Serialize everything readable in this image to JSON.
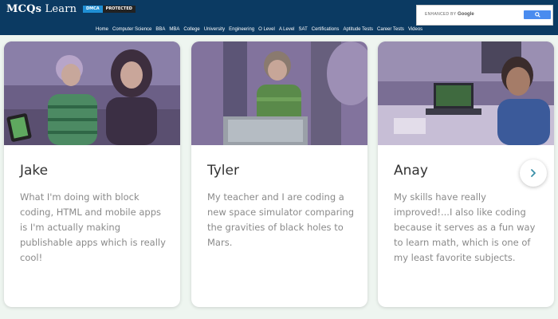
{
  "header": {
    "brand_part1": "MCQs",
    "brand_part2": "Learn",
    "dmca_label": "DMCA",
    "protected_label": "PROTECTED",
    "search": {
      "enhanced_by": "ENHANCED BY",
      "provider": "Google",
      "button_icon": "search-icon"
    },
    "nav": [
      "Home",
      "Computer Science",
      "BBA",
      "MBA",
      "College",
      "University",
      "Engineering",
      "O Level",
      "A Level",
      "SAT",
      "Certifications",
      "Aptitude Tests",
      "Career Tests",
      "Videos"
    ]
  },
  "testimonials": [
    {
      "name": "Jake",
      "quote": "What I'm doing with block coding, HTML and mobile apps is I'm actually making publishable apps which is really cool!"
    },
    {
      "name": "Tyler",
      "quote": "My teacher and I are coding a new space simulator comparing the gravities of black holes to Mars."
    },
    {
      "name": "Anay",
      "quote": "My skills have really improved!...I also like coding because it serves as a fun way to learn math, which is one of my least favorite subjects."
    }
  ],
  "colors": {
    "header_bg": "#0b3a62",
    "page_bg": "#eef5f0",
    "dmca_blue": "#1f8fd4",
    "search_btn": "#4a8cef"
  },
  "next_icon": "chevron-right-icon"
}
